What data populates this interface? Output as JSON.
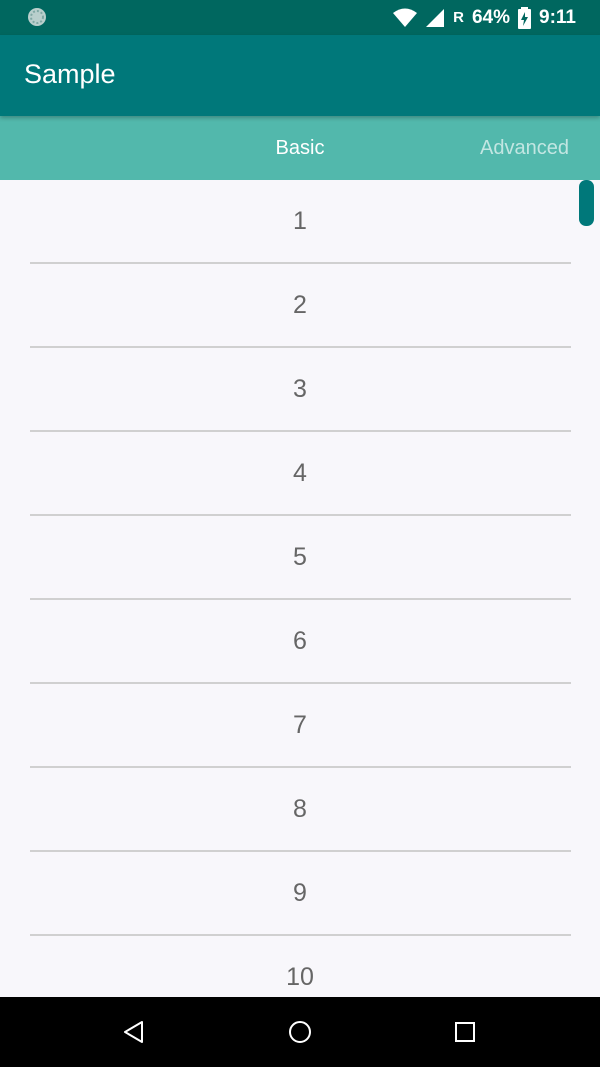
{
  "status_bar": {
    "signal_letter": "R",
    "battery_text": "64%",
    "time": "9:11"
  },
  "app_bar": {
    "title": "Sample"
  },
  "tabs": [
    {
      "label": "Basic",
      "selected": true
    },
    {
      "label": "Advanced",
      "selected": false
    }
  ],
  "list": {
    "items": [
      "1",
      "2",
      "3",
      "4",
      "5",
      "6",
      "7",
      "8",
      "9",
      "10"
    ]
  },
  "nav_bar": {
    "icons": [
      "back-icon",
      "home-icon",
      "recents-icon"
    ]
  },
  "colors": {
    "status_bar": "#00675f",
    "app_bar": "#00787a",
    "tab_bar": "#52b8ac",
    "list_background": "#f8f7fb",
    "scroll_thumb": "#00787a"
  }
}
